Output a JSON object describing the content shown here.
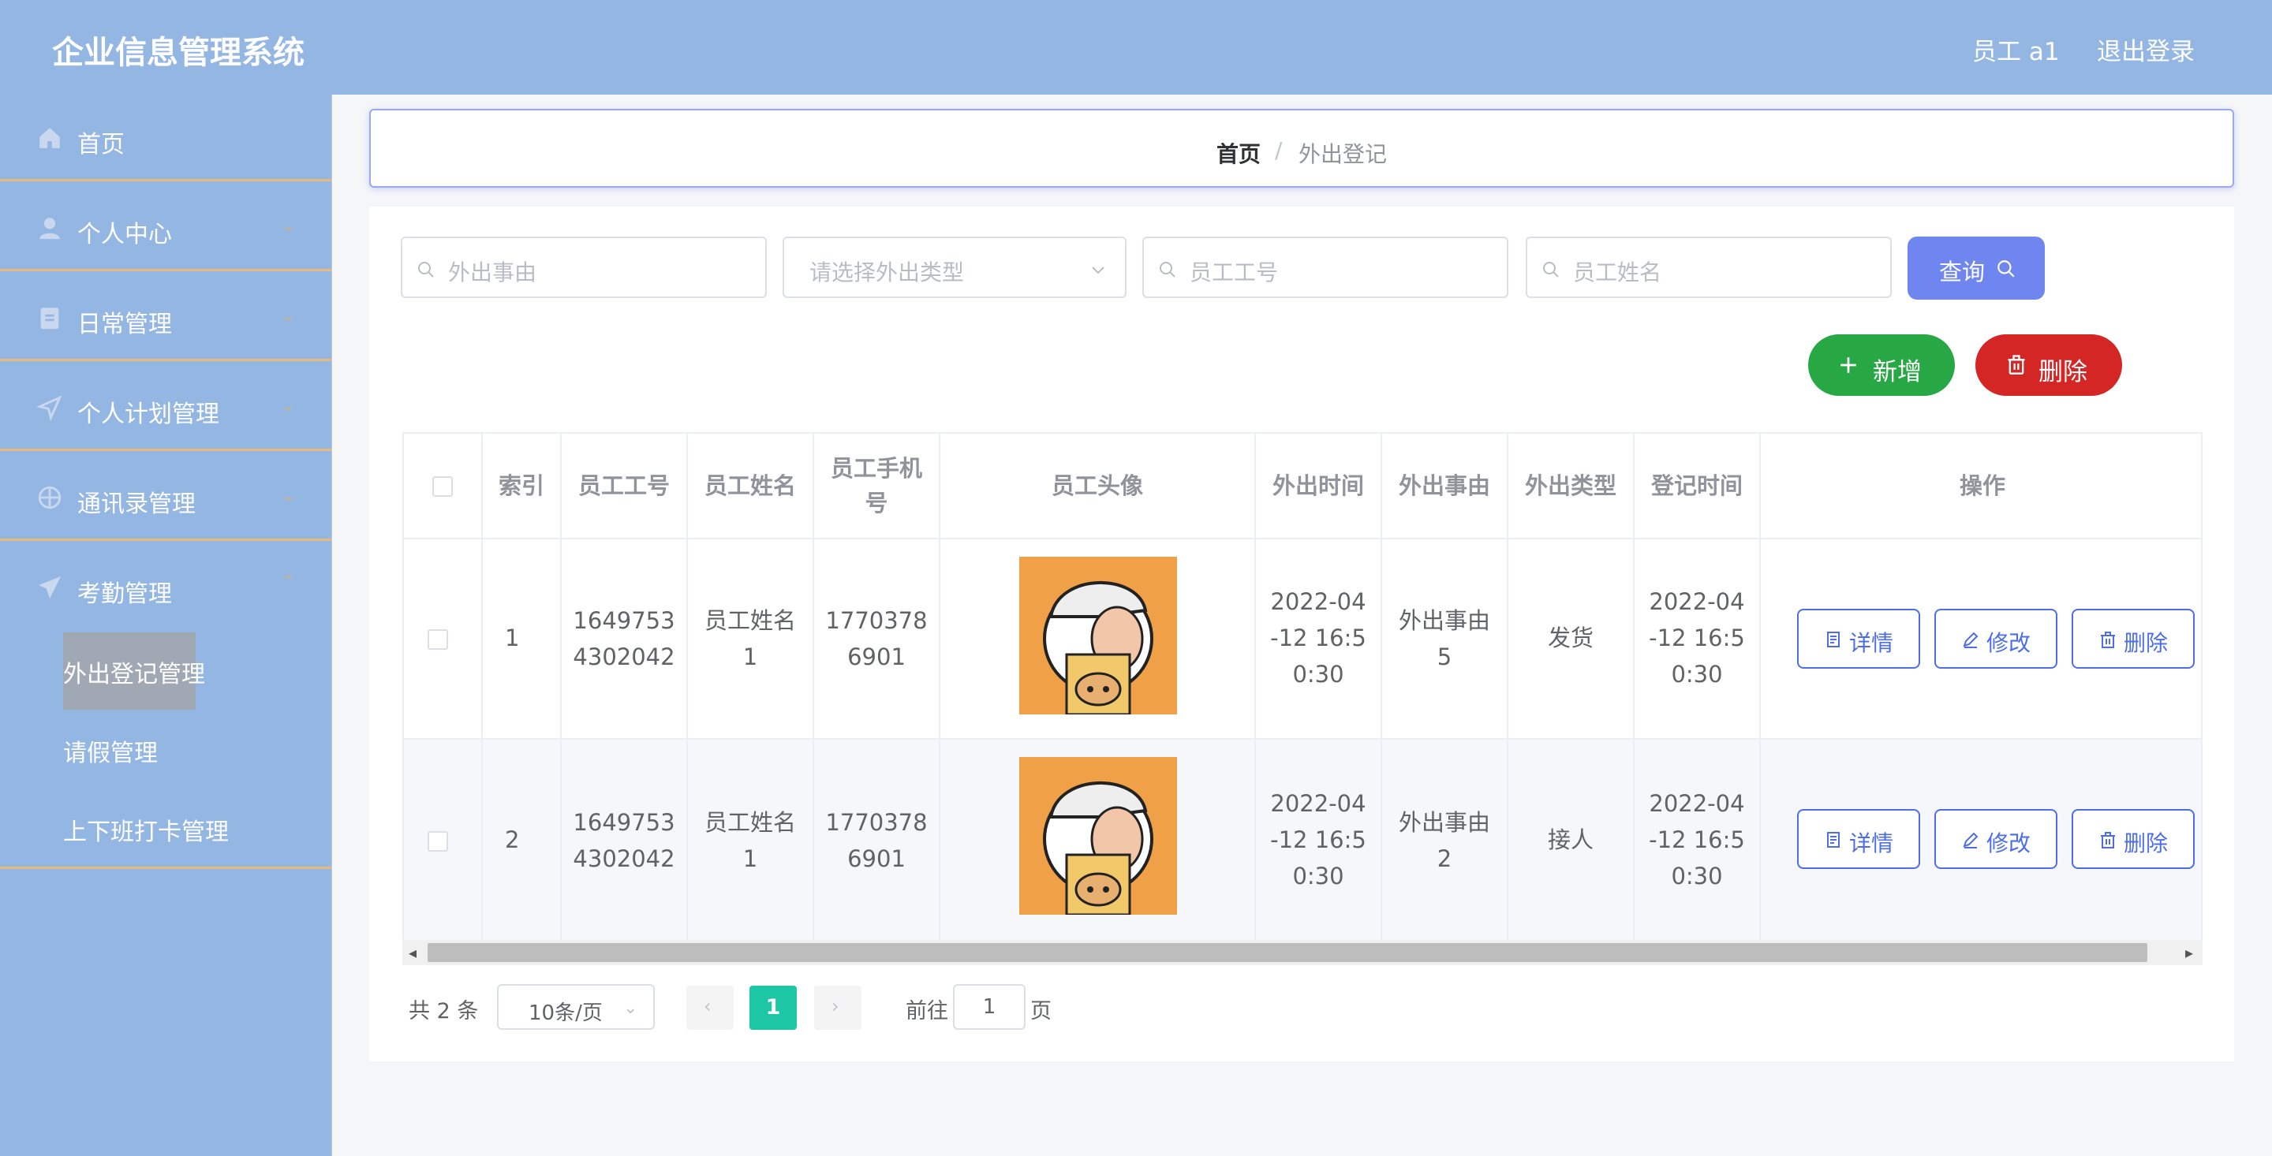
{
  "app": {
    "title": "企业信息管理系统",
    "user": "员工 a1",
    "logout": "退出登录"
  },
  "menu": [
    {
      "label": "首页",
      "icon": "home-icon"
    },
    {
      "label": "个人中心",
      "icon": "user-icon"
    },
    {
      "label": "日常管理",
      "icon": "clipboard-icon"
    },
    {
      "label": "个人计划管理",
      "icon": "send-icon"
    },
    {
      "label": "通讯录管理",
      "icon": "compass-icon"
    },
    {
      "label": "考勤管理",
      "icon": "paper-plane-icon"
    }
  ],
  "submenu": [
    "外出登记管理",
    "请假管理",
    "上下班打卡管理"
  ],
  "breadcrumb": {
    "home": "首页",
    "separator": "/",
    "current": "外出登记"
  },
  "search": {
    "reason_placeholder": "外出事由",
    "type_placeholder": "请选择外出类型",
    "emp_no_placeholder": "员工工号",
    "emp_name_placeholder": "员工姓名",
    "query_label": "查询"
  },
  "actions": {
    "add_label": "新增",
    "delete_label": "删除"
  },
  "colors": {
    "primary": "#4d6ee8",
    "success": "#28a745",
    "danger": "#d52626",
    "page_active": "#1dc6a4",
    "header": "#94b6e3"
  },
  "table": {
    "headers": [
      "索引",
      "员工工号",
      "员工姓名",
      "员工手机号",
      "员工头像",
      "外出时间",
      "外出事由",
      "外出类型",
      "登记时间",
      "操作"
    ],
    "header_phone_lines": [
      "员工手机",
      "号"
    ],
    "rows": [
      {
        "index": "1",
        "emp_no": [
          "1649753",
          "4302042"
        ],
        "emp_name": [
          "员工姓名",
          "1"
        ],
        "phone": [
          "1770378",
          "6901"
        ],
        "out_time": [
          "2022-04",
          "-12 16:5",
          "0:30"
        ],
        "reason": [
          "外出事由",
          "5"
        ],
        "type": "发货",
        "reg_time": [
          "2022-04",
          "-12 16:5",
          "0:30"
        ]
      },
      {
        "index": "2",
        "emp_no": [
          "1649753",
          "4302042"
        ],
        "emp_name": [
          "员工姓名",
          "1"
        ],
        "phone": [
          "1770378",
          "6901"
        ],
        "out_time": [
          "2022-04",
          "-12 16:5",
          "0:30"
        ],
        "reason": [
          "外出事由",
          "2"
        ],
        "type": "接人",
        "reg_time": [
          "2022-04",
          "-12 16:5",
          "0:30"
        ]
      }
    ],
    "op_labels": {
      "detail": "详情",
      "edit": "修改",
      "delete": "删除"
    }
  },
  "pagination": {
    "total": "共 2 条",
    "page_size": "10条/页",
    "current": "1",
    "goto_prefix": "前往",
    "goto_value": "1",
    "goto_suffix": "页"
  }
}
